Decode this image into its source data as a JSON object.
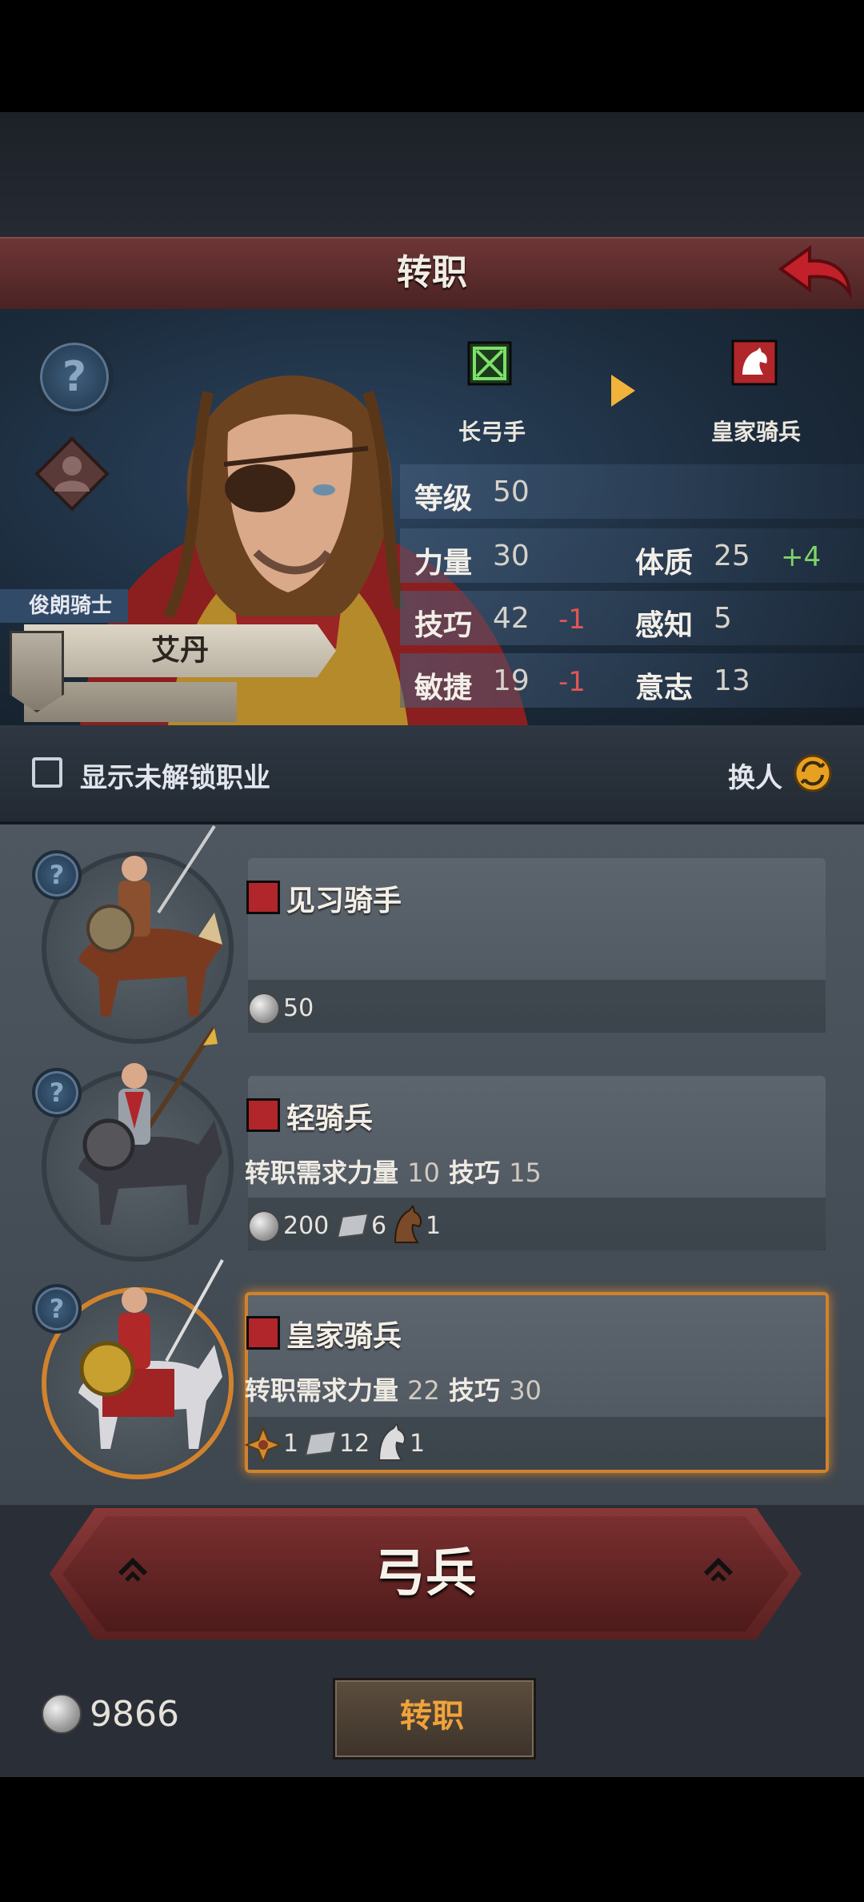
{
  "header": {
    "title": "转职"
  },
  "hero": {
    "title_tag": "俊朗骑士",
    "name": "艾丹",
    "current_class": "长弓手",
    "target_class": "皇家骑兵",
    "stats": {
      "level_label": "等级",
      "level": "50",
      "str_label": "力量",
      "str": "30",
      "con_label": "体质",
      "con": "25",
      "con_delta": "+4",
      "skill_label": "技巧",
      "skill": "42",
      "skill_delta": "-1",
      "per_label": "感知",
      "per": "5",
      "agi_label": "敏捷",
      "agi": "19",
      "agi_delta": "-1",
      "will_label": "意志",
      "will": "13"
    }
  },
  "filter": {
    "show_locked_label": "显示未解锁职业",
    "swap_label": "换人"
  },
  "classes": [
    {
      "name": "见习骑手",
      "req_prefix": "",
      "costs": {
        "silver": "50"
      }
    },
    {
      "name": "轻骑兵",
      "req_prefix": "转职需求",
      "req1_label": "力量",
      "req1_val": "10",
      "req2_label": "技巧",
      "req2_val": "15",
      "costs": {
        "silver": "200",
        "ingot": "6",
        "horse": "1"
      }
    },
    {
      "name": "皇家骑兵",
      "req_prefix": "转职需求",
      "req1_label": "力量",
      "req1_val": "22",
      "req2_label": "技巧",
      "req2_val": "30",
      "costs": {
        "emblem": "1",
        "ingot": "12",
        "horse": "1"
      }
    }
  ],
  "big_button": {
    "label": "弓兵"
  },
  "footer": {
    "silver": "9866",
    "action_label": "转职"
  },
  "colors": {
    "accent": "#d0822d",
    "title_bar": "#6e3636",
    "minus": "#e05555",
    "plus": "#7ed46a"
  }
}
